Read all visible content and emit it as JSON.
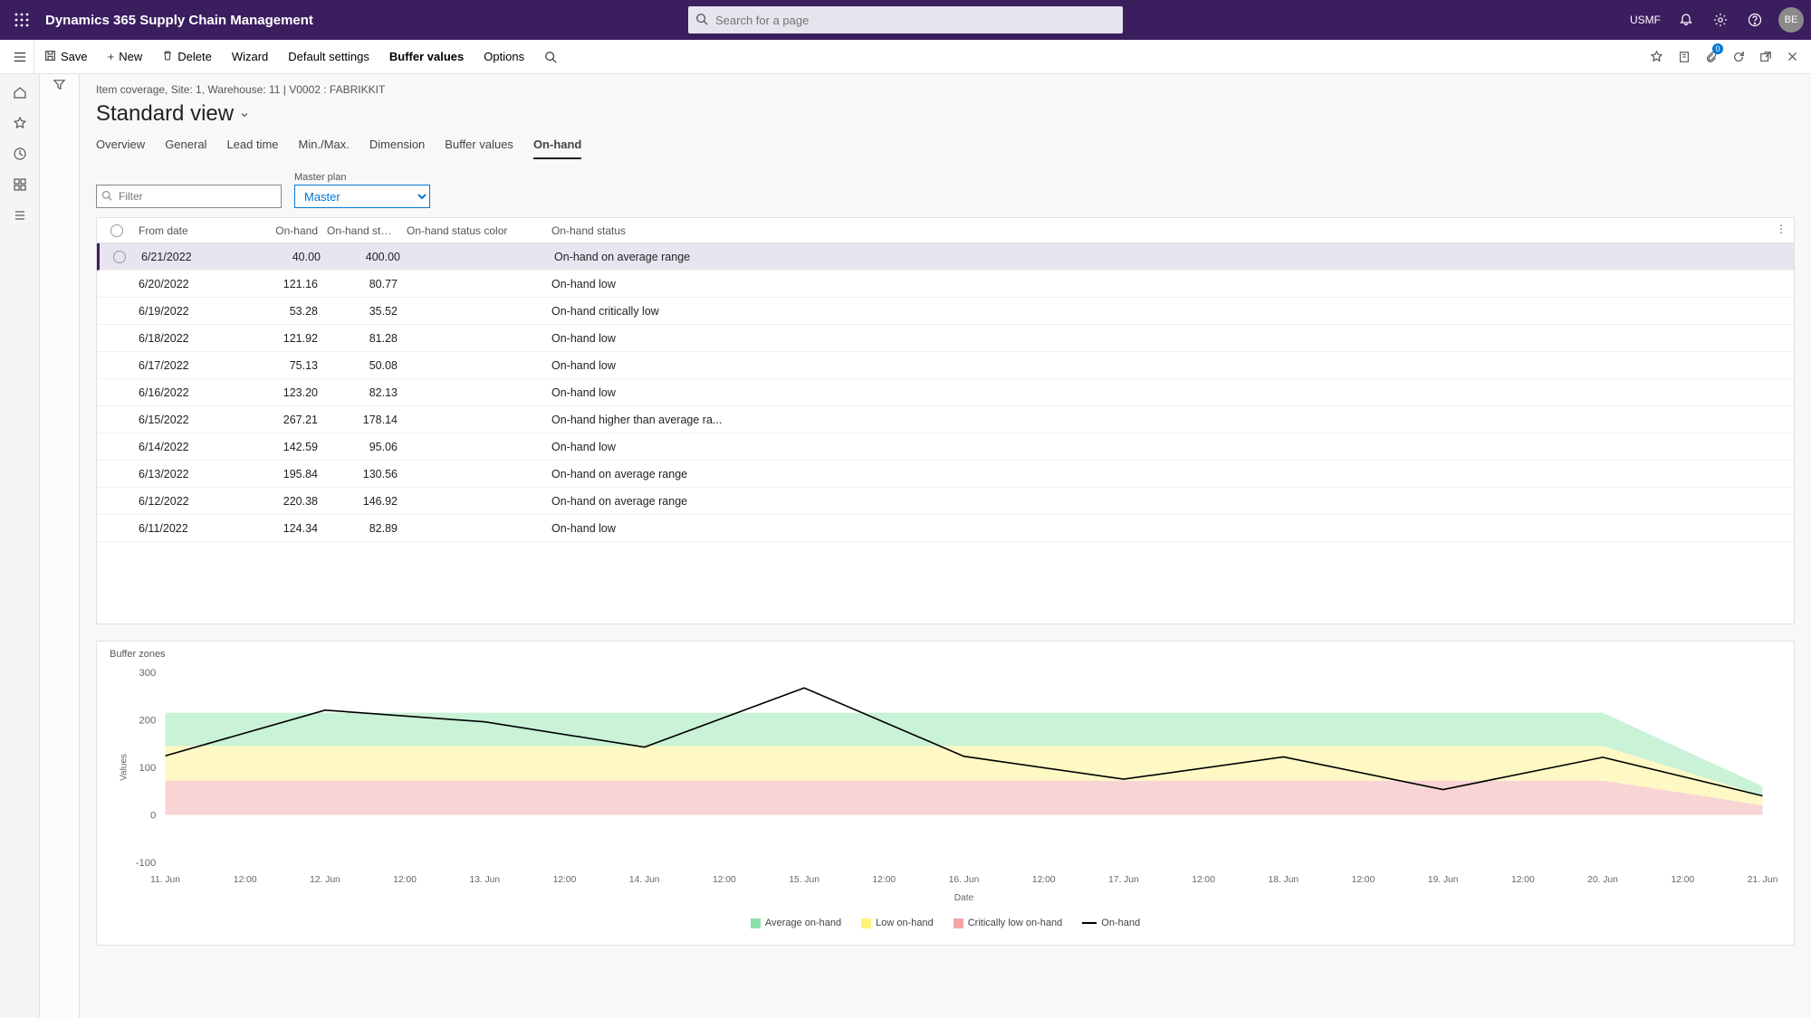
{
  "app_title": "Dynamics 365 Supply Chain Management",
  "search_placeholder": "Search for a page",
  "entity": "USMF",
  "avatar": "BE",
  "actionbar": {
    "save": "Save",
    "new": "New",
    "delete": "Delete",
    "wizard": "Wizard",
    "default_settings": "Default settings",
    "buffer_values": "Buffer values",
    "options": "Options",
    "attach_badge": "0"
  },
  "breadcrumb": "Item coverage, Site: 1, Warehouse: 11   |   V0002 : FABRIKKIT",
  "view_name": "Standard view",
  "tabs": [
    "Overview",
    "General",
    "Lead time",
    "Min./Max.",
    "Dimension",
    "Buffer values",
    "On-hand"
  ],
  "active_tab": 6,
  "filter_placeholder": "Filter",
  "master_plan_label": "Master plan",
  "master_plan_value": "Master",
  "grid": {
    "headers": {
      "from_date": "From date",
      "on_hand": "On-hand",
      "on_hand_status_num": "On-hand statu...",
      "on_hand_status_color": "On-hand status color",
      "on_hand_status": "On-hand status"
    },
    "rows": [
      {
        "date": "6/21/2022",
        "oh": "40.00",
        "ohs": "400.00",
        "color": "green",
        "status": "On-hand on average range"
      },
      {
        "date": "6/20/2022",
        "oh": "121.16",
        "ohs": "80.77",
        "color": "yellow",
        "status": "On-hand low"
      },
      {
        "date": "6/19/2022",
        "oh": "53.28",
        "ohs": "35.52",
        "color": "red",
        "status": "On-hand critically low"
      },
      {
        "date": "6/18/2022",
        "oh": "121.92",
        "ohs": "81.28",
        "color": "yellow",
        "status": "On-hand low"
      },
      {
        "date": "6/17/2022",
        "oh": "75.13",
        "ohs": "50.08",
        "color": "yellow",
        "status": "On-hand low"
      },
      {
        "date": "6/16/2022",
        "oh": "123.20",
        "ohs": "82.13",
        "color": "yellow",
        "status": "On-hand low"
      },
      {
        "date": "6/15/2022",
        "oh": "267.21",
        "ohs": "178.14",
        "color": "purple",
        "status": "On-hand higher than average ra..."
      },
      {
        "date": "6/14/2022",
        "oh": "142.59",
        "ohs": "95.06",
        "color": "yellow",
        "status": "On-hand low"
      },
      {
        "date": "6/13/2022",
        "oh": "195.84",
        "ohs": "130.56",
        "color": "green",
        "status": "On-hand on average range"
      },
      {
        "date": "6/12/2022",
        "oh": "220.38",
        "ohs": "146.92",
        "color": "green",
        "status": "On-hand on average range"
      },
      {
        "date": "6/11/2022",
        "oh": "124.34",
        "ohs": "82.89",
        "color": "yellow",
        "status": "On-hand low"
      }
    ]
  },
  "chart": {
    "title": "Buffer zones",
    "ylabel": "Values",
    "xlabel": "Date",
    "legend": {
      "avg": "Average on-hand",
      "low": "Low on-hand",
      "crit": "Critically low on-hand",
      "onhand": "On-hand"
    }
  },
  "chart_data": {
    "type": "line",
    "title": "Buffer zones",
    "xlabel": "Date",
    "ylabel": "Values",
    "ylim": [
      -100,
      300
    ],
    "x_ticks": [
      "11. Jun",
      "12:00",
      "12. Jun",
      "12:00",
      "13. Jun",
      "12:00",
      "14. Jun",
      "12:00",
      "15. Jun",
      "12:00",
      "16. Jun",
      "12:00",
      "17. Jun",
      "12:00",
      "18. Jun",
      "12:00",
      "19. Jun",
      "12:00",
      "20. Jun",
      "12:00",
      "21. Jun"
    ],
    "y_ticks": [
      -100,
      0,
      100,
      200,
      300
    ],
    "categories": [
      "11. Jun",
      "12. Jun",
      "13. Jun",
      "14. Jun",
      "15. Jun",
      "16. Jun",
      "17. Jun",
      "18. Jun",
      "19. Jun",
      "20. Jun",
      "21. Jun"
    ],
    "series": [
      {
        "name": "On-hand",
        "values": [
          124.34,
          220.38,
          195.84,
          142.59,
          267.21,
          123.2,
          75.13,
          121.92,
          53.28,
          121.16,
          40.0
        ]
      }
    ],
    "bands": {
      "average_top": [
        215,
        215,
        215,
        215,
        215,
        215,
        215,
        215,
        215,
        215,
        60
      ],
      "low_top": [
        145,
        145,
        145,
        145,
        145,
        145,
        145,
        145,
        145,
        145,
        40
      ],
      "crit_top": [
        72,
        72,
        72,
        72,
        72,
        72,
        72,
        72,
        72,
        72,
        20
      ],
      "floor": [
        0,
        0,
        0,
        0,
        0,
        0,
        0,
        0,
        0,
        0,
        0
      ]
    },
    "colors": {
      "avg": "#c9f2d7",
      "low": "#fdf8c4",
      "crit": "#f8d4d4",
      "line": "#000000"
    }
  }
}
